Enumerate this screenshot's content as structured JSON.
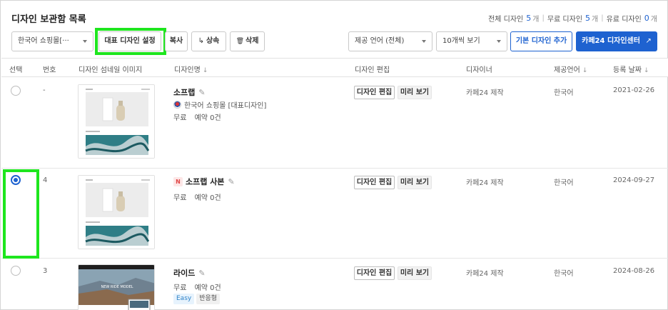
{
  "header": {
    "title": "디자인 보관함 목록",
    "counts": [
      {
        "label": "전체 디자인",
        "value": "5",
        "unit": "개"
      },
      {
        "label": "무료 디자인",
        "value": "5",
        "unit": "개"
      },
      {
        "label": "유료 디자인",
        "value": "0",
        "unit": "개"
      }
    ]
  },
  "toolbar": {
    "mall_select": "한국어 쇼핑몰[···",
    "set_default": "대표 디자인 설정",
    "copy": "복사",
    "inherit_icon": "↳",
    "inherit": "상속",
    "delete_icon": "🗑",
    "delete": "삭제",
    "language_select": "제공 언어 (전체)",
    "per_page_select": "10개씩 보기",
    "add_basic": "기본 디자인 추가",
    "design_center": "카페24 디자인센터",
    "external_icon": "↗"
  },
  "columns": {
    "select": "선택",
    "number": "번호",
    "thumbnail": "디자인 섬네일 이미지",
    "name": "디자인명",
    "edit": "디자인 편집",
    "designer": "디자이너",
    "language": "제공언어",
    "date": "등록 날짜",
    "sort_icon": "↓"
  },
  "actions": {
    "edit": "디자인 편집",
    "preview": "미리 보기",
    "pencil_icon": "✎"
  },
  "rows": [
    {
      "number": "-",
      "selected": false,
      "name": "소프랩",
      "is_new": false,
      "new_badge": "",
      "mall": "한국어 쇼핑몰 [대표디자인]",
      "price": "무료",
      "reservation": "예약 0건",
      "tags": [],
      "designer": "카페24 제작",
      "language": "한국어",
      "date": "2021-02-26"
    },
    {
      "number": "4",
      "selected": true,
      "name": "소프랩 사본",
      "is_new": true,
      "new_badge": "N",
      "mall": "",
      "price": "무료",
      "reservation": "예약 0건",
      "tags": [],
      "designer": "카페24 제작",
      "language": "한국어",
      "date": "2024-09-27"
    },
    {
      "number": "3",
      "selected": false,
      "name": "라이드",
      "is_new": false,
      "new_badge": "",
      "mall": "",
      "price": "무료",
      "reservation": "예약 0건",
      "tags": [
        "Easy",
        "반응형"
      ],
      "designer": "카페24 제작",
      "language": "한국어",
      "date": "2024-08-26"
    }
  ],
  "thumbnail_text": {
    "hero": "NEW RIDE MODEL"
  },
  "colors": {
    "accent": "#1e62d0",
    "highlight": "#1ee61e",
    "new_badge": "#e04545"
  }
}
